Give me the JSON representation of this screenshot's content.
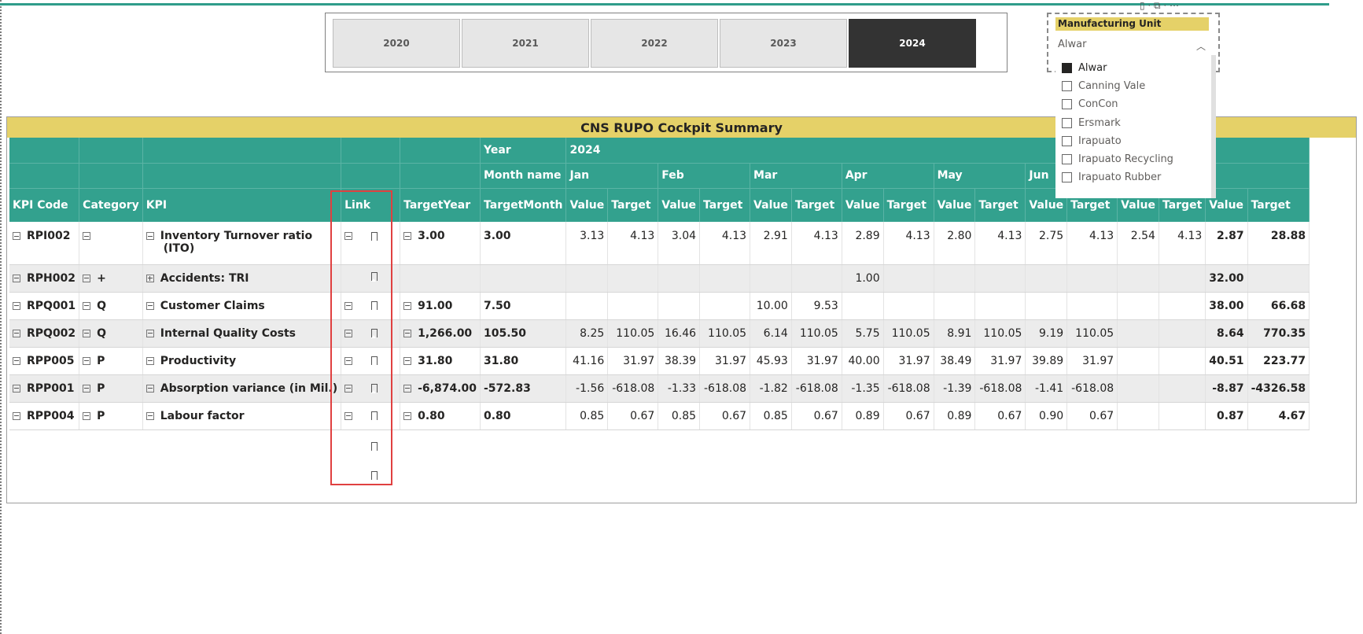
{
  "year_slicer": {
    "years": [
      "2020",
      "2021",
      "2022",
      "2023",
      "2024"
    ],
    "selected": "2024"
  },
  "visual": {
    "title": "CNS RUPO Cockpit Summary"
  },
  "matrix": {
    "row_headers": [
      "KPI Code",
      "Category",
      "KPI",
      "Link",
      "TargetYear",
      "TargetMonth"
    ],
    "year_label": "Year",
    "year_value": "2024",
    "month_label": "Month name",
    "months": [
      "Jan",
      "Feb",
      "Mar",
      "Apr",
      "May",
      "Jun"
    ],
    "value_label": "Value",
    "target_label": "Target",
    "rows": [
      {
        "code": "RPI002",
        "category": "",
        "kpi": "Inventory Turnover ratio",
        "kpi2": "(ITO)",
        "target_year": "3.00",
        "target_month": "3.00",
        "cells": [
          "3.13",
          "4.13",
          "3.04",
          "4.13",
          "2.91",
          "4.13",
          "2.89",
          "4.13",
          "2.80",
          "4.13",
          "2.75",
          "4.13",
          "2.54",
          "4.13"
        ],
        "total_value": "2.87",
        "total_target": "28.88"
      },
      {
        "code": "RPH002",
        "category": "+",
        "kpi": "Accidents: TRI",
        "kpi2": "",
        "target_year": "",
        "target_month": "",
        "cells": [
          "",
          "",
          "",
          "",
          "",
          "",
          "1.00",
          "",
          "",
          "",
          "",
          "",
          "",
          ""
        ],
        "total_value": "32.00",
        "total_target": ""
      },
      {
        "code": "RPQ001",
        "category": "Q",
        "kpi": "Customer Claims",
        "kpi2": "",
        "target_year": "91.00",
        "target_month": "7.50",
        "cells": [
          "",
          "",
          "",
          "",
          "10.00",
          "9.53",
          "",
          "",
          "",
          "",
          "",
          "",
          "",
          ""
        ],
        "total_value": "38.00",
        "total_target": "66.68"
      },
      {
        "code": "RPQ002",
        "category": "Q",
        "kpi": "Internal Quality Costs",
        "kpi2": "",
        "target_year": "1,266.00",
        "target_month": "105.50",
        "cells": [
          "8.25",
          "110.05",
          "16.46",
          "110.05",
          "6.14",
          "110.05",
          "5.75",
          "110.05",
          "8.91",
          "110.05",
          "9.19",
          "110.05",
          "",
          ""
        ],
        "total_value": "8.64",
        "total_target": "770.35"
      },
      {
        "code": "RPP005",
        "category": "P",
        "kpi": "Productivity",
        "kpi2": "",
        "target_year": "31.80",
        "target_month": "31.80",
        "cells": [
          "41.16",
          "31.97",
          "38.39",
          "31.97",
          "45.93",
          "31.97",
          "40.00",
          "31.97",
          "38.49",
          "31.97",
          "39.89",
          "31.97",
          "",
          ""
        ],
        "total_value": "40.51",
        "total_target": "223.77"
      },
      {
        "code": "RPP001",
        "category": "P",
        "kpi": "Absorption variance (in Mil.)",
        "kpi2": "",
        "target_year": "-6,874.00",
        "target_month": "-572.83",
        "cells": [
          "-1.56",
          "-618.08",
          "-1.33",
          "-618.08",
          "-1.82",
          "-618.08",
          "-1.35",
          "-618.08",
          "-1.39",
          "-618.08",
          "-1.41",
          "-618.08",
          "",
          ""
        ],
        "total_value": "-8.87",
        "total_target": "-4326.58"
      },
      {
        "code": "RPP004",
        "category": "P",
        "kpi": "Labour factor",
        "kpi2": "",
        "target_year": "0.80",
        "target_month": "0.80",
        "cells": [
          "0.85",
          "0.67",
          "0.85",
          "0.67",
          "0.85",
          "0.67",
          "0.89",
          "0.67",
          "0.89",
          "0.67",
          "0.90",
          "0.67",
          "",
          ""
        ],
        "total_value": "0.87",
        "total_target": "4.67"
      }
    ]
  },
  "manufacturing_unit": {
    "title": "Manufacturing Unit",
    "selected": "Alwar",
    "options": [
      {
        "label": "Alwar",
        "checked": true
      },
      {
        "label": "Canning Vale",
        "checked": false
      },
      {
        "label": "ConCon",
        "checked": false
      },
      {
        "label": "Ersmark",
        "checked": false
      },
      {
        "label": "Irapuato",
        "checked": false
      },
      {
        "label": "Irapuato Recycling",
        "checked": false
      },
      {
        "label": "Irapuato Rubber",
        "checked": false
      }
    ]
  },
  "colors": {
    "header_teal": "#33a18e",
    "title_yellow": "#e5d168",
    "selected_year": "#333333",
    "highlight_red": "#e04040"
  },
  "icons": {
    "expand": "plus-minus-box-icon",
    "bookmark": "bookmark-icon",
    "chevron": "chevron-up-icon"
  }
}
